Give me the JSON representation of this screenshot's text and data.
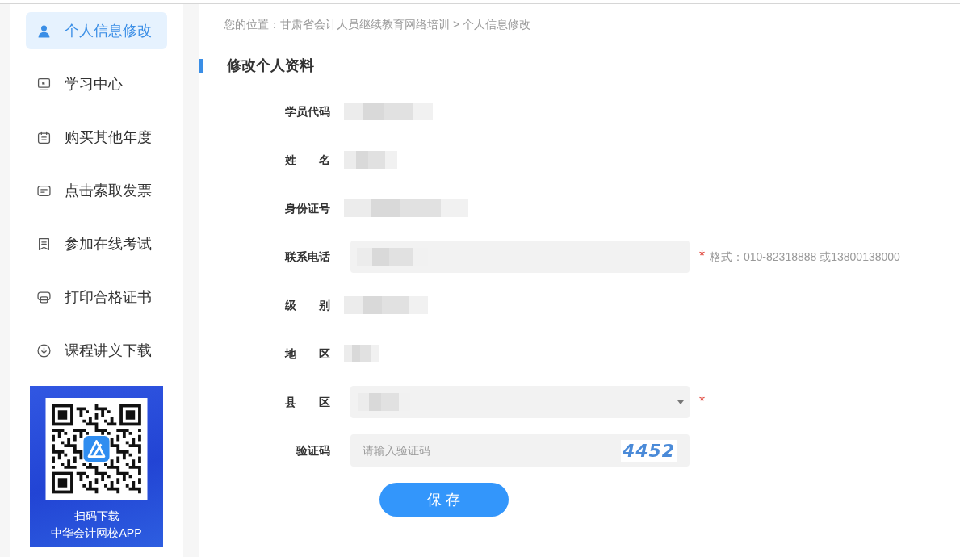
{
  "sidebar": {
    "items": [
      {
        "label": "个人信息修改",
        "selected": true
      },
      {
        "label": "学习中心",
        "selected": false
      },
      {
        "label": "购买其他年度",
        "selected": false
      },
      {
        "label": "点击索取发票",
        "selected": false
      },
      {
        "label": "参加在线考试",
        "selected": false
      },
      {
        "label": "打印合格证书",
        "selected": false
      },
      {
        "label": "课程讲义下载",
        "selected": false
      }
    ],
    "app_promo": {
      "caption": "扫码下载",
      "app_name": "中华会计网校APP"
    }
  },
  "breadcrumb": "您的位置：甘肃省会计人员继续教育网络培训 > 个人信息修改",
  "heading": "修改个人资料",
  "form": {
    "fields": [
      {
        "kind": "text",
        "label": "学员代码",
        "value_hidden": true
      },
      {
        "kind": "text",
        "label": "姓　　名",
        "value_hidden": true
      },
      {
        "kind": "text",
        "label": "身份证号",
        "value_hidden": true
      },
      {
        "kind": "input",
        "label": "联系电话",
        "value_hidden": true,
        "required_mark": "*",
        "hint": "格式：010-82318888 或13800138000"
      },
      {
        "kind": "text",
        "label": "级　　别",
        "value_hidden": true
      },
      {
        "kind": "text",
        "label": "地　　区",
        "value_hidden": true
      },
      {
        "kind": "select",
        "label": "县　　区",
        "value_hidden": true,
        "required_mark": "*"
      },
      {
        "kind": "captcha",
        "label": "验证码",
        "placeholder": "请输入验证码",
        "captcha": "4452"
      }
    ],
    "submit": "保 存"
  }
}
